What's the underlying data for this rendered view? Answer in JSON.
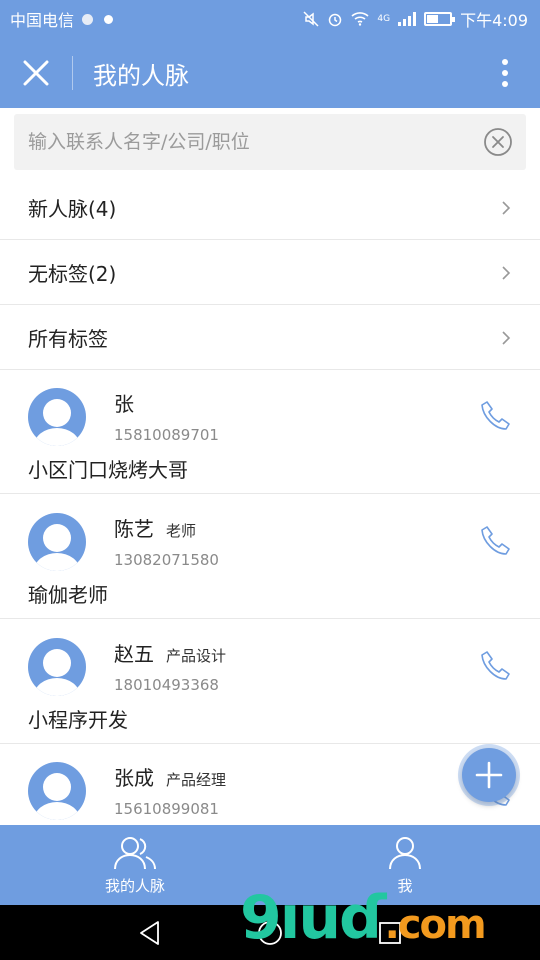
{
  "status_bar": {
    "carrier": "中国电信",
    "time": "下午4:09",
    "network": "4G"
  },
  "header": {
    "title": "我的人脉"
  },
  "search": {
    "placeholder": "输入联系人名字/公司/职位"
  },
  "menu": [
    {
      "label": "新人脉(4)"
    },
    {
      "label": "无标签(2)"
    },
    {
      "label": "所有标签"
    }
  ],
  "contacts": [
    {
      "name": "张",
      "title": "",
      "phone": "15810089701",
      "note": "小区门口烧烤大哥"
    },
    {
      "name": "陈艺",
      "title": "老师",
      "phone": "13082071580",
      "note": "瑜伽老师"
    },
    {
      "name": "赵五",
      "title": "产品设计",
      "phone": "18010493368",
      "note": "小程序开发"
    },
    {
      "name": "张成",
      "title": "产品经理",
      "phone": "15610899081",
      "note": ""
    }
  ],
  "tabs": [
    {
      "label": "我的人脉",
      "icon": "contacts-icon"
    },
    {
      "label": "我",
      "icon": "user-icon"
    }
  ],
  "watermark": {
    "main": "9ıuɗ",
    "suffix": ".com"
  },
  "colors": {
    "primary": "#6f9de0",
    "text": "#222222",
    "secondary_text": "#8a8a8a",
    "divider": "#e8e8e8"
  }
}
